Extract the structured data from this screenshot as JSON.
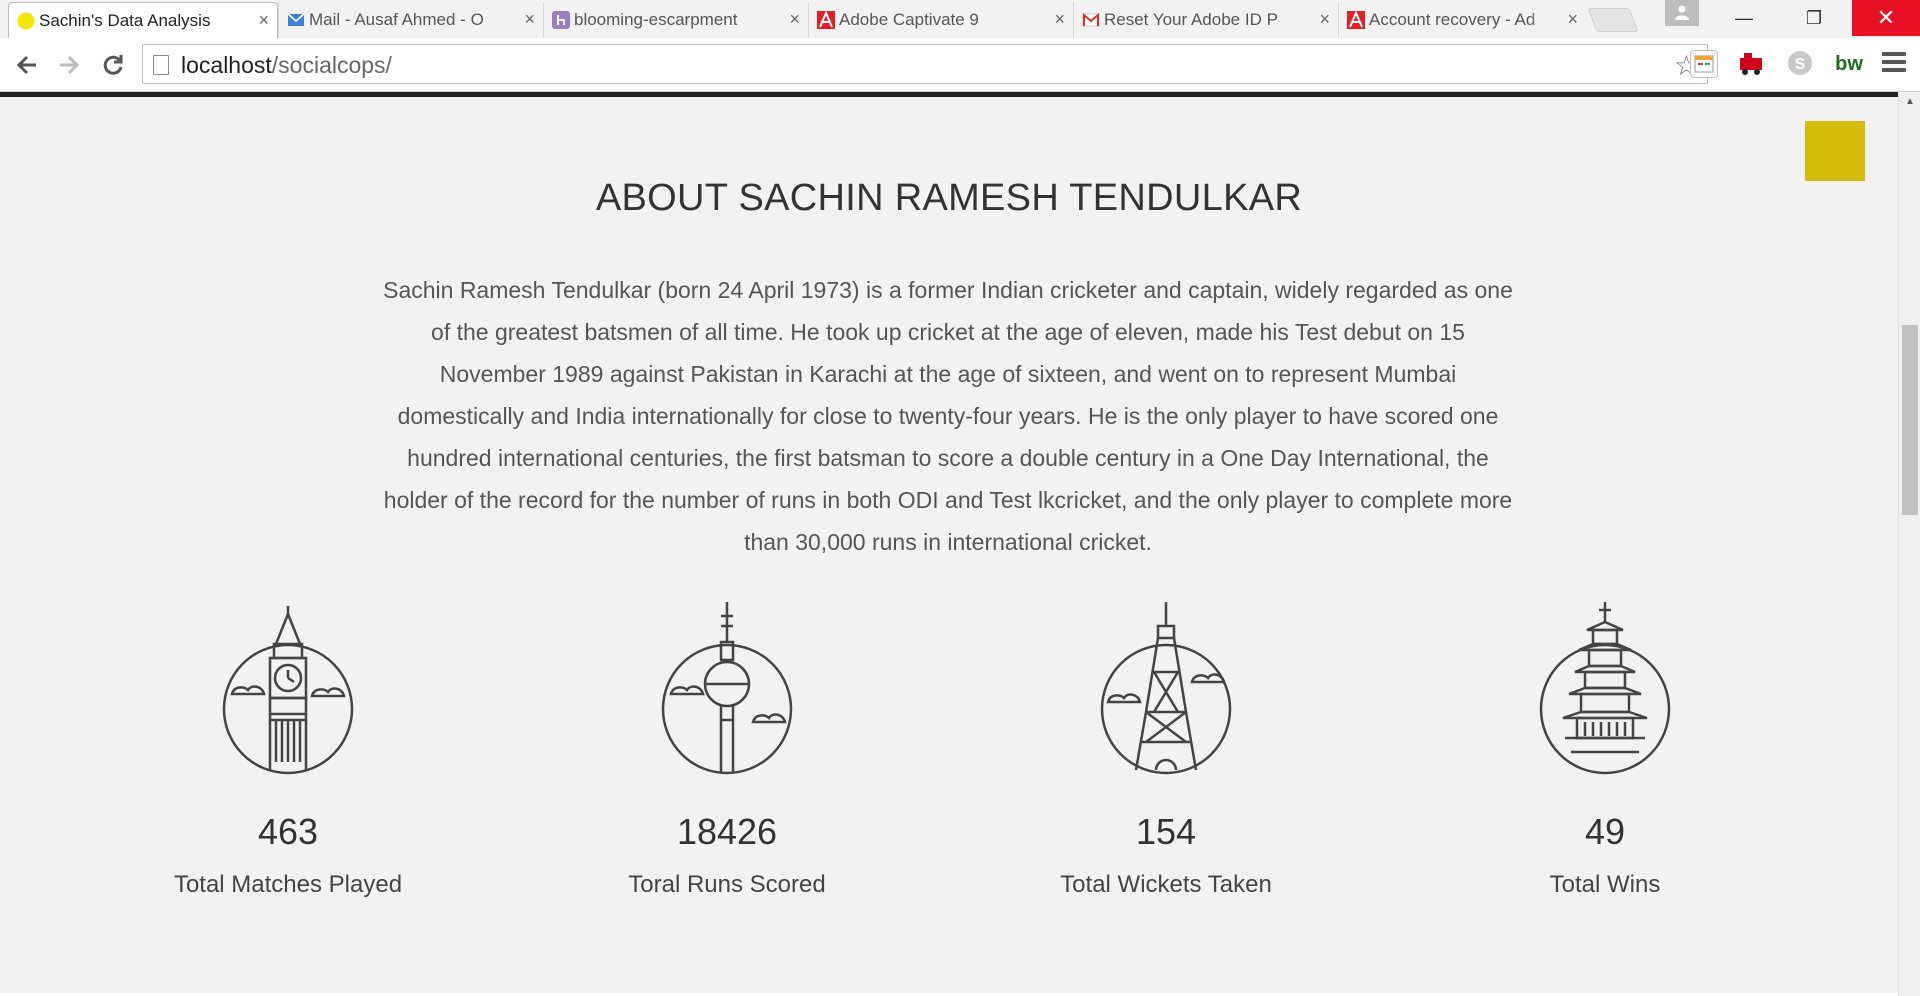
{
  "browser": {
    "tabs": [
      {
        "title": "Sachin's Data Analysis",
        "favicon": "yellow-circle-icon",
        "active": true
      },
      {
        "title": "Mail - Ausaf Ahmed - O",
        "favicon": "mail-envelope-icon",
        "active": false
      },
      {
        "title": "blooming-escarpment",
        "favicon": "heroku-icon",
        "active": false
      },
      {
        "title": "Adobe Captivate 9",
        "favicon": "adobe-icon",
        "active": false
      },
      {
        "title": "Reset Your Adobe ID P",
        "favicon": "gmail-icon",
        "active": false
      },
      {
        "title": "Account recovery - Ad",
        "favicon": "adobe-icon",
        "active": false
      }
    ],
    "close_glyph": "×",
    "url_host": "localhost",
    "url_path": "/socialcops/",
    "window_controls": {
      "minimize": "—",
      "restore": "❐",
      "close": "✕"
    },
    "ext_bw_label": "bw"
  },
  "about": {
    "title": "ABOUT SACHIN RAMESH TENDULKAR",
    "text": "Sachin Ramesh Tendulkar (born 24 April 1973) is a former Indian cricketer and captain, widely regarded as one of the greatest batsmen of all time. He took up cricket at the age of eleven, made his Test debut on 15 November 1989 against Pakistan in Karachi at the age of sixteen, and went on to represent Mumbai domestically and India internationally for close to twenty-four years. He is the only player to have scored one hundred international centuries, the first batsman to score a double century in a One Day International, the holder of the record for the number of runs in both ODI and Test lkcricket, and the only player to complete more than 30,000 runs in international cricket."
  },
  "stats": [
    {
      "value": "463",
      "label": "Total Matches Played",
      "icon": "big-ben-icon"
    },
    {
      "value": "18426",
      "label": "Toral Runs Scored",
      "icon": "berlin-tv-tower-icon"
    },
    {
      "value": "154",
      "label": "Total Wickets Taken",
      "icon": "eiffel-tower-icon"
    },
    {
      "value": "49",
      "label": "Total Wins",
      "icon": "pagoda-icon"
    }
  ],
  "colors": {
    "accent_square": "#d4bb0c",
    "close_button": "#e81123"
  }
}
